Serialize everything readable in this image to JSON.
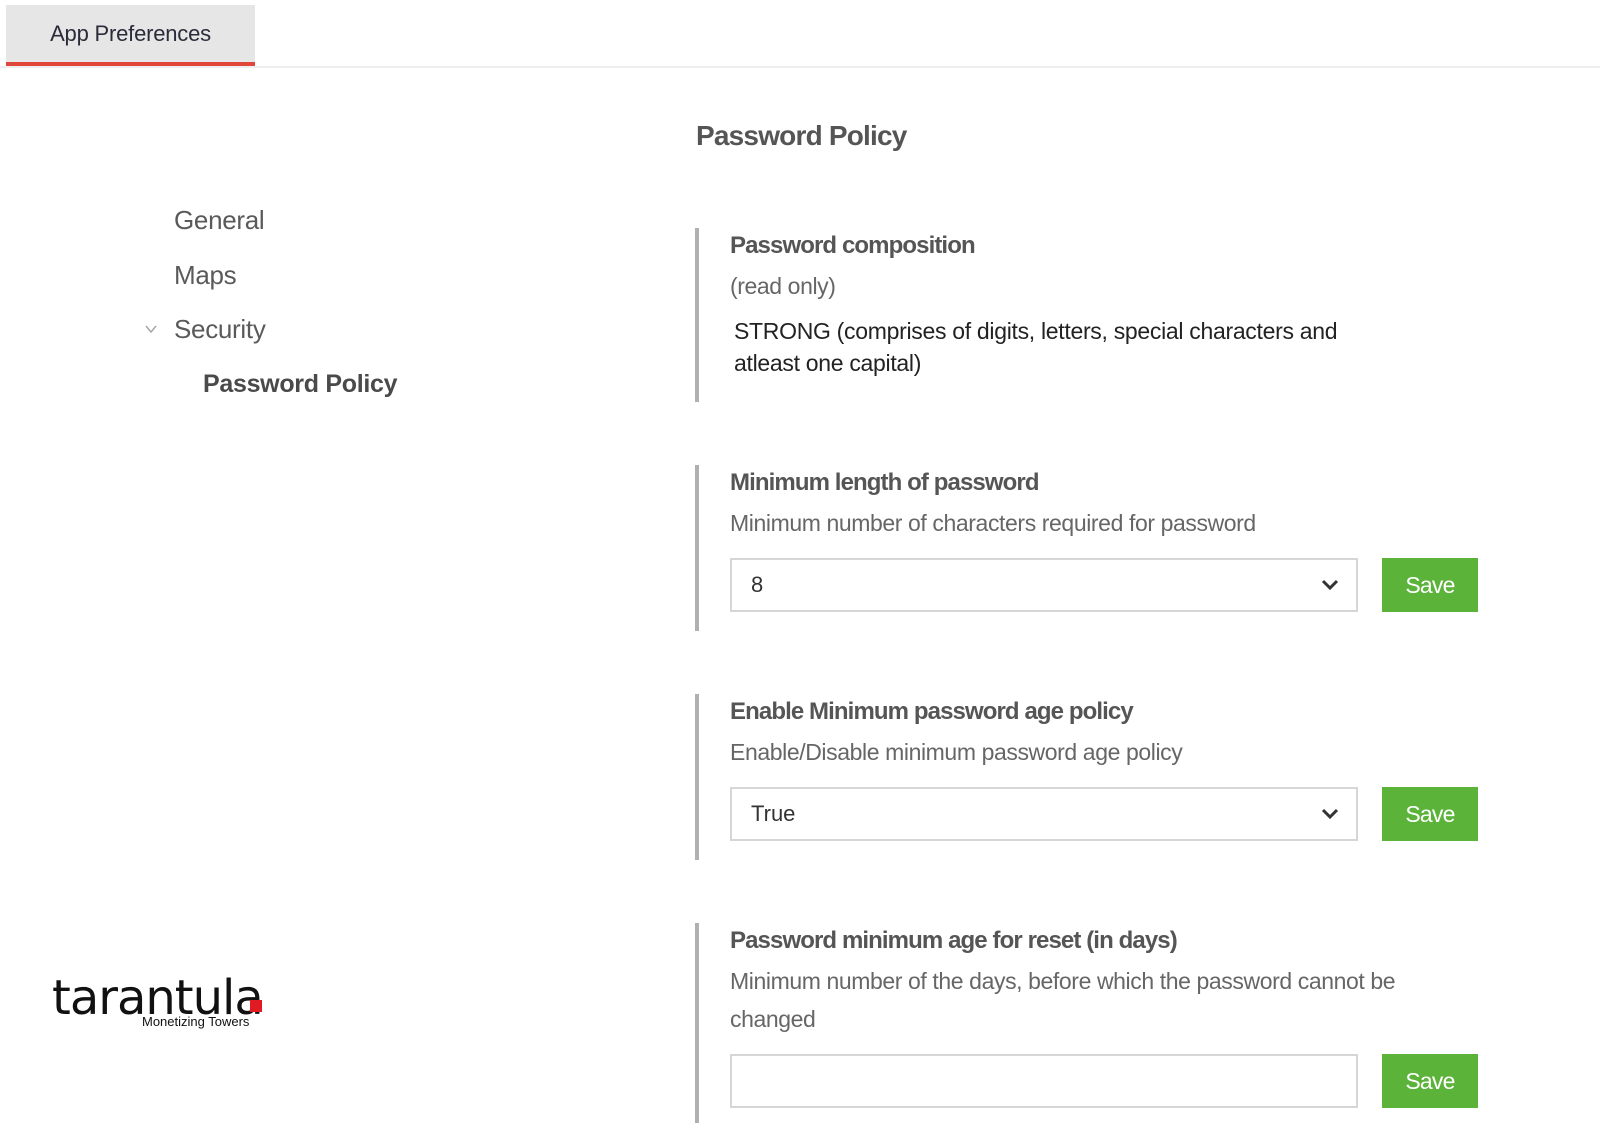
{
  "header": {
    "tabs": [
      {
        "label": "App Preferences",
        "active": true
      }
    ],
    "accent_color": "#e0463a"
  },
  "sidebar": {
    "items": [
      {
        "label": "General",
        "level": 0
      },
      {
        "label": "Maps",
        "level": 0
      },
      {
        "label": "Security",
        "level": 0,
        "expanded": true,
        "icon": "chevron-down-icon"
      },
      {
        "label": "Password Policy",
        "level": 1,
        "active": true
      }
    ]
  },
  "main": {
    "title": "Password Policy",
    "sections": [
      {
        "title": "Password composition",
        "description": "(read only)",
        "value": "STRONG (comprises of digits, letters, special characters and atleast one capital)"
      },
      {
        "title": "Minimum length of password",
        "description": "Minimum number of characters required for password",
        "select_value": "8",
        "save_label": "Save"
      },
      {
        "title": "Enable Minimum password age policy",
        "description": "Enable/Disable minimum password age policy",
        "select_value": "True",
        "save_label": "Save"
      },
      {
        "title": "Password minimum age for reset (in days)",
        "description": "Minimum number of the days, before which the password cannot be changed",
        "select_value": "",
        "save_label": "Save"
      }
    ],
    "save_color": "#5bb33a"
  },
  "logo": {
    "name": "tarantula",
    "tagline": "Monetizing Towers",
    "dot_color": "#e01b24"
  }
}
